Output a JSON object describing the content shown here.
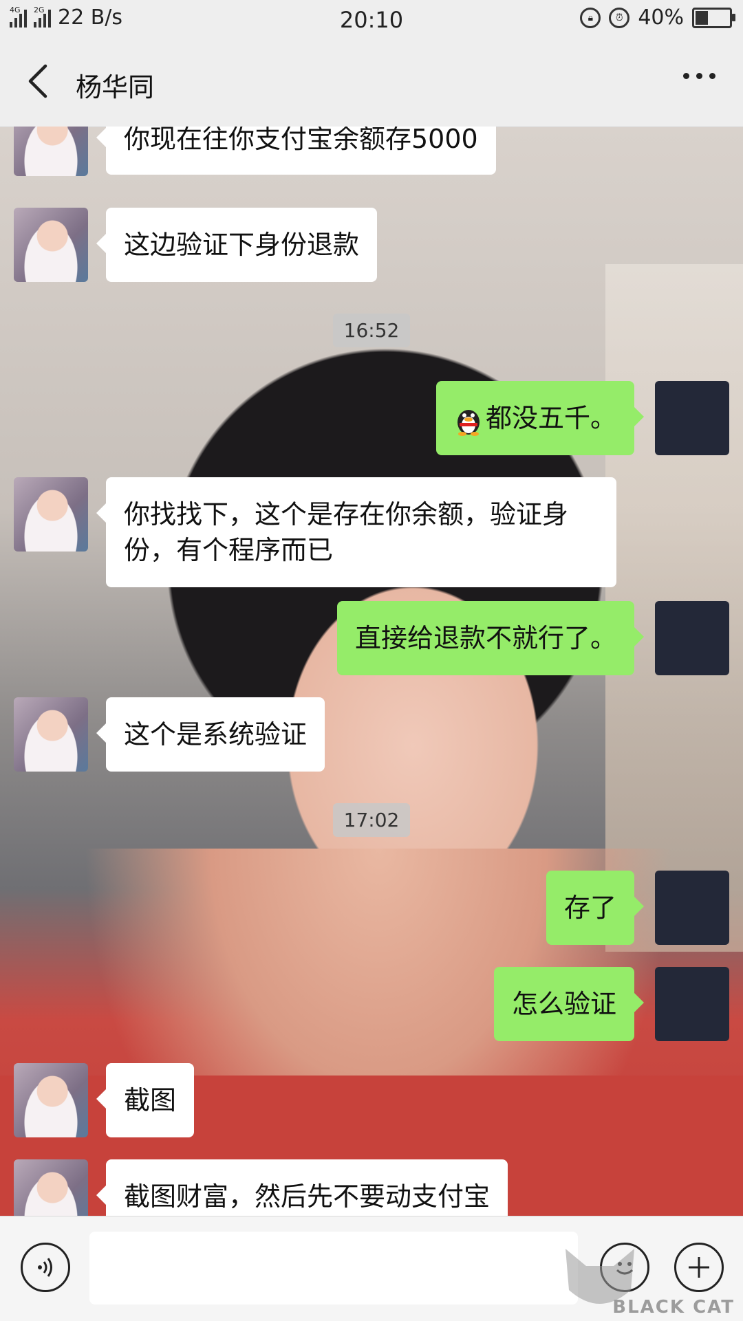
{
  "status_bar": {
    "network_1": "4G",
    "network_2": "2G",
    "speed": "22 B/s",
    "time": "20:10",
    "battery": "40%",
    "battery_level": 0.4
  },
  "header": {
    "title": "杨华同"
  },
  "messages": [
    {
      "side": "in",
      "text": "你现在往你支付宝余额存5000"
    },
    {
      "side": "in",
      "text": "这边验证下身份退款"
    },
    {
      "type": "time",
      "text": "16:52"
    },
    {
      "side": "out",
      "text": "都没五千。",
      "emoji": "penguin"
    },
    {
      "side": "in",
      "text": "你找找下，这个是存在你余额，验证身份，有个程序而已"
    },
    {
      "side": "out",
      "text": "直接给退款不就行了。"
    },
    {
      "side": "in",
      "text": "这个是系统验证"
    },
    {
      "type": "time",
      "text": "17:02"
    },
    {
      "side": "out",
      "text": "存了"
    },
    {
      "side": "out",
      "text": "怎么验证"
    },
    {
      "side": "in",
      "text": "截图"
    },
    {
      "side": "in",
      "text": "截图财富，然后先不要动支付宝"
    }
  ],
  "input": {
    "value": ""
  },
  "watermark": {
    "text": "BLACK CAT"
  },
  "colors": {
    "bubble_out": "#95ec69",
    "bubble_in": "#ffffff",
    "bar_bg": "#eeeeee"
  }
}
